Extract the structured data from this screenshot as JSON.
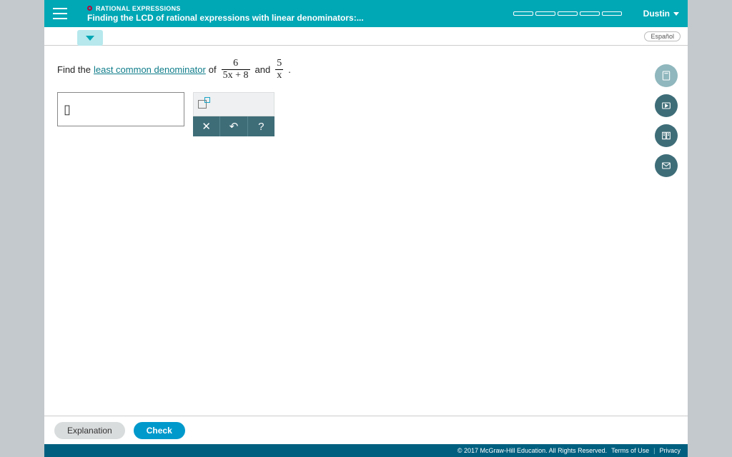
{
  "header": {
    "topic": "RATIONAL EXPRESSIONS",
    "title": "Finding the LCD of rational expressions with linear denominators:...",
    "user": "Dustin"
  },
  "subbar": {
    "espanol": "Español"
  },
  "prompt": {
    "prefix": "Find the",
    "link": "least common denominator",
    "of": "of",
    "frac1_num": "6",
    "frac1_den": "5x + 8",
    "and": "and",
    "frac2_num": "5",
    "frac2_den": "x",
    "period": "."
  },
  "answer": {
    "placeholder": "▯"
  },
  "tools": {
    "close": "✕",
    "undo": "↶",
    "help": "?"
  },
  "footer": {
    "explanation": "Explanation",
    "check": "Check"
  },
  "copyright": {
    "text": "© 2017 McGraw-Hill Education. All Rights Reserved.",
    "terms": "Terms of Use",
    "privacy": "Privacy"
  }
}
